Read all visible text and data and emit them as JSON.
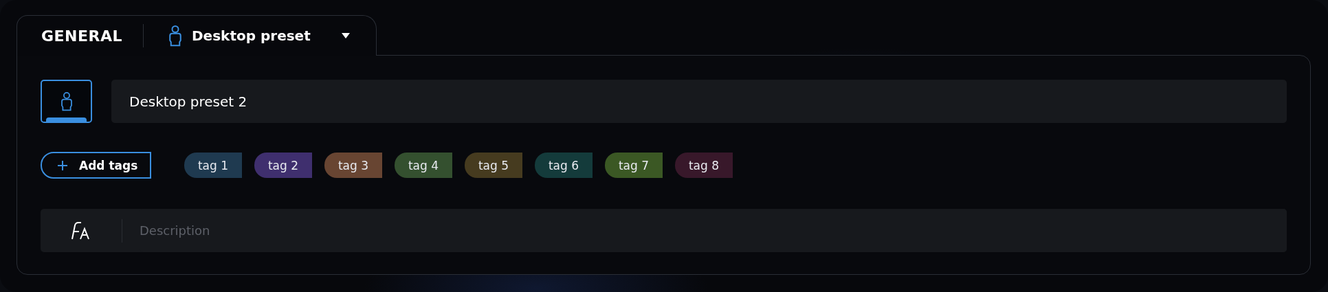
{
  "tab": {
    "title": "GENERAL",
    "preset": "Desktop preset"
  },
  "name_field": {
    "value": "Desktop preset 2"
  },
  "add_tags_button": "Add tags",
  "tags": [
    {
      "label": "tag 1",
      "color": "#1f3a50"
    },
    {
      "label": "tag 2",
      "color": "#3f2f6e"
    },
    {
      "label": "tag 3",
      "color": "#684532"
    },
    {
      "label": "tag 4",
      "color": "#34502f"
    },
    {
      "label": "tag 5",
      "color": "#463b1f"
    },
    {
      "label": "tag 6",
      "color": "#143b3b"
    },
    {
      "label": "tag 7",
      "color": "#3b5824"
    },
    {
      "label": "tag 8",
      "color": "#38182a"
    }
  ],
  "description": {
    "placeholder": "Description"
  }
}
